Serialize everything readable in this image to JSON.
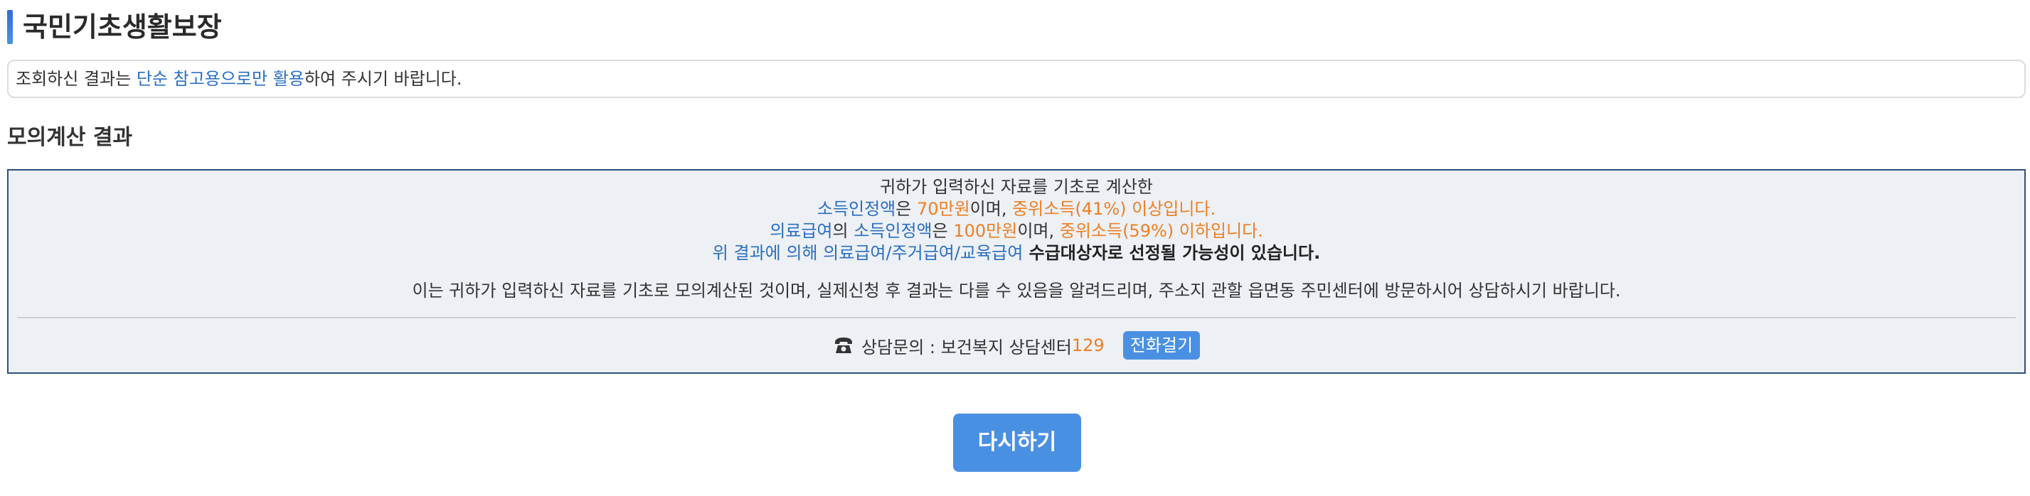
{
  "page": {
    "title": "국민기초생활보장"
  },
  "notice": {
    "prefix": "조회하신 결과는 ",
    "highlight": "단순 참고용으로만 활용",
    "suffix": "하여 주시기 바랍니다."
  },
  "section": {
    "heading": "모의계산 결과"
  },
  "result": {
    "line1": "귀하가 입력하신 자료를 기초로 계산한",
    "line2": {
      "label": "소득인정액",
      "particle": "은 ",
      "amount": "70만원",
      "mid": "이며, ",
      "status": "중위소득(41%) 이상입니다."
    },
    "line3": {
      "benefit": "의료급여",
      "particle1": "의 ",
      "label": "소득인정액",
      "particle2": "은 ",
      "amount": "100만원",
      "mid": "이며, ",
      "status": "중위소득(59%) 이하입니다."
    },
    "line4": {
      "benefits": "위 결과에 의해 의료급여/주거급여/교육급여",
      "conclusion": " 수급대상자로 선정될 가능성이 있습니다."
    },
    "disclaimer": "이는 귀하가 입력하신 자료를 기초로 모의계산된 것이며, 실제신청 후 결과는 다를 수 있음을 알려드리며, 주소지 관할 읍면동 주민센터에 방문하시어 상담하시기 바랍니다."
  },
  "contact": {
    "icon": "telephone-icon",
    "label": "상담문의 : 보건복지 상담센터 ",
    "number": "129",
    "call_button": "전화걸기"
  },
  "actions": {
    "retry": "다시하기"
  },
  "colors": {
    "accent_blue": "#2a6fc2",
    "accent_orange": "#ee7f22",
    "button_blue": "#4a90e2",
    "result_border": "#2d4f7e",
    "result_bg": "#edf0f5"
  }
}
